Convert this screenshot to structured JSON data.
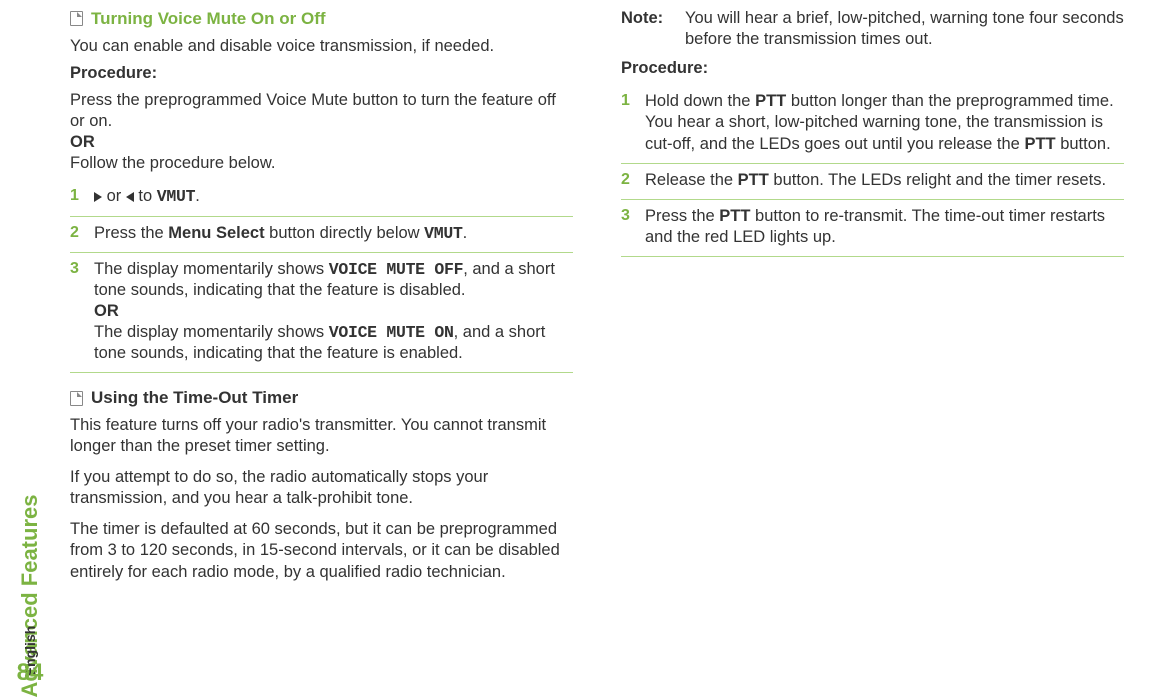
{
  "spine": {
    "section": "Advanced Features",
    "language": "English",
    "page_number": "84"
  },
  "left": {
    "sec1_title": "Turning Voice Mute On or Off",
    "sec1_intro": "You can enable and disable voice transmission, if needed.",
    "procedure_label": "Procedure:",
    "sec1_pre_a": "Press the preprogrammed Voice Mute button to turn the feature off or on.",
    "or": "OR",
    "sec1_pre_b": "Follow the procedure below.",
    "sec1_steps": {
      "n1": "1",
      "n2": "2",
      "n3": "3",
      "s1_or": " or ",
      "s1_to": " to ",
      "s1_target": "VMUT",
      "s1_end": ".",
      "s2_a": "Press the ",
      "s2_b": "Menu Select",
      "s2_c": " button directly below ",
      "s2_d": "VMUT",
      "s2_e": ".",
      "s3_a": "The display momentarily shows ",
      "s3_b": "VOICE MUTE OFF",
      "s3_c": ", and a short tone sounds, indicating that the feature is disabled.",
      "s3_or": "OR",
      "s3_d": "The display momentarily shows ",
      "s3_e": "VOICE MUTE ON",
      "s3_f": ", and a short tone sounds, indicating that the feature is enabled."
    },
    "sec2_title": "Using the Time-Out Timer",
    "sec2_p1": "This feature turns off your radio's transmitter. You cannot transmit longer than the preset timer setting.",
    "sec2_p2": "If you attempt to do so, the radio automatically stops your transmission, and you hear a talk-prohibit tone.",
    "sec2_p3": "The timer is defaulted at 60 seconds, but it can be preprogrammed from 3 to 120 seconds, in 15-second intervals, or it can be disabled entirely for each radio mode, by a qualified radio technician."
  },
  "right": {
    "note_label": "Note:",
    "note_body": "You will hear a brief, low-pitched, warning tone four seconds before the transmission times out.",
    "procedure_label": "Procedure:",
    "steps": {
      "n1": "1",
      "n2": "2",
      "n3": "3",
      "s1_a": "Hold down the ",
      "s1_b": "PTT",
      "s1_c": " button longer than the preprogrammed time. You hear a short, low-pitched warning tone, the transmission is cut-off, and the LEDs goes out until you release the ",
      "s1_d": "PTT",
      "s1_e": " button.",
      "s2_a": "Release the ",
      "s2_b": "PTT",
      "s2_c": " button. The LEDs relight and the timer resets.",
      "s3_a": "Press the ",
      "s3_b": "PTT",
      "s3_c": " button to re-transmit. The time-out timer restarts and the red LED lights up."
    }
  }
}
